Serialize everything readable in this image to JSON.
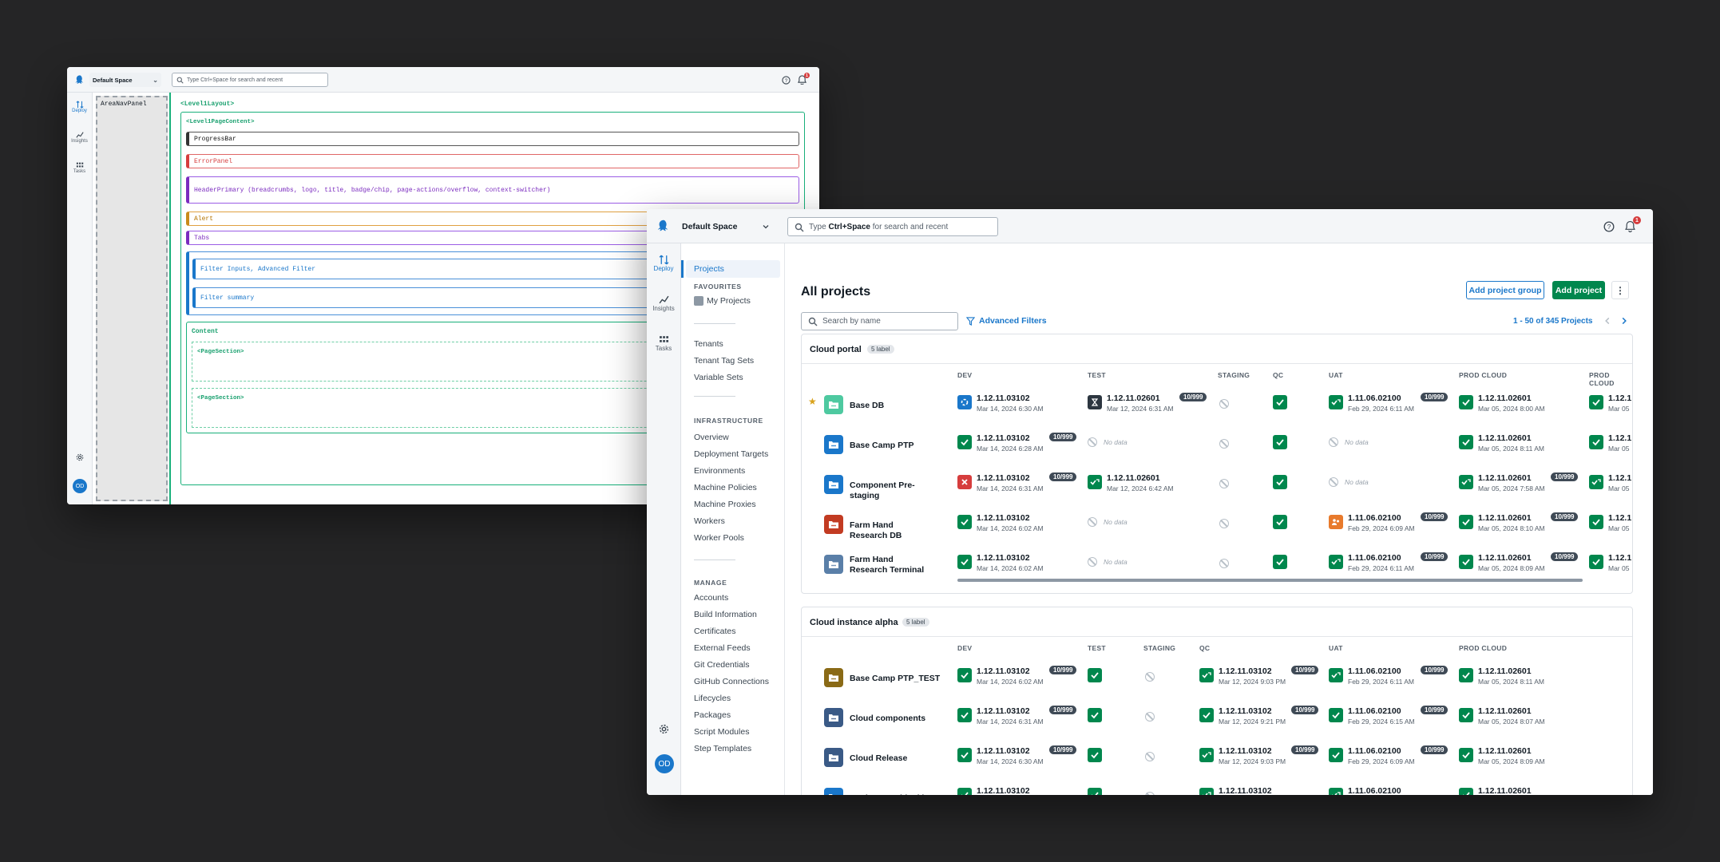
{
  "back_window": {
    "space_label": "Default Space",
    "search_placeholder": "Type Ctrl+Space for search and recent",
    "notif_count": "1",
    "rail": [
      {
        "label": "Deploy",
        "icon": "deploy-icon"
      },
      {
        "label": "Insights",
        "icon": "insights-icon"
      },
      {
        "label": "Tasks",
        "icon": "tasks-icon"
      }
    ],
    "avatar": "OD",
    "area_nav_panel": "AreaNavPanel",
    "level1_layout": "<Level1Layout>",
    "level1_page_content": "<Level1PageContent>",
    "progress_bar": "ProgressBar",
    "error_panel": "ErrorPanel",
    "header_primary": "HeaderPrimary (breadcrumbs, logo, title, badge/chip, page-actions/overflow, context-switcher)",
    "alert": "Alert",
    "tabs": "Tabs",
    "filter_inputs": "Filter Inputs, Advanced Filter",
    "filter_summary": "Filter summary",
    "content": "Content",
    "page_section_1": "<PageSection>",
    "page_section_2": "<PageSection>"
  },
  "front_window": {
    "space_label": "Default Space",
    "search_placeholder_pre": "Type ",
    "search_placeholder_key": "Ctrl+Space",
    "search_placeholder_post": " for search and recent",
    "notif_count": "1",
    "rail": [
      {
        "label": "Deploy",
        "icon": "deploy-icon"
      },
      {
        "label": "Insights",
        "icon": "insights-icon"
      },
      {
        "label": "Tasks",
        "icon": "tasks-icon"
      }
    ],
    "avatar": "OD",
    "sidebar": {
      "projects": "Projects",
      "favourites_heading": "FAVOURITES",
      "my_projects": "My Projects",
      "group1": [
        "Tenants",
        "Tenant Tag Sets",
        "Variable Sets"
      ],
      "infrastructure_heading": "INFRASTRUCTURE",
      "infrastructure": [
        "Overview",
        "Deployment Targets",
        "Environments",
        "Machine Policies",
        "Machine Proxies",
        "Workers",
        "Worker Pools"
      ],
      "manage_heading": "MANAGE",
      "manage": [
        "Accounts",
        "Build Information",
        "Certificates",
        "External Feeds",
        "Git Credentials",
        "GitHub Connections",
        "Lifecycles",
        "Packages",
        "Script Modules",
        "Step Templates"
      ]
    },
    "page_title": "All projects",
    "add_project_group": "Add project group",
    "add_project": "Add project",
    "search_by_name": "Search by name",
    "advanced_filters": "Advanced Filters",
    "pagination": "1 - 50 of 345 Projects",
    "groups": [
      {
        "name": "Cloud portal",
        "label": "5 label",
        "columns": [
          "DEV",
          "TEST",
          "STAGING",
          "QC",
          "UAT",
          "PROD CLOUD",
          "PROD CLOUD"
        ],
        "rows": [
          {
            "name": "Base DB",
            "favourite": true,
            "dev": {
              "status": "in-progress",
              "rel": "1.12.11.03102",
              "date": "Mar 14, 2024 6:30 AM"
            },
            "test": {
              "status": "queued",
              "rel": "1.12.11.02601",
              "date": "Mar 12, 2024 6:31 AM",
              "tag": "10/999"
            },
            "qc": {
              "status": "success"
            },
            "uat": {
              "status": "success-arrow",
              "rel": "1.11.06.02100",
              "date": "Feb 29, 2024 6:11 AM",
              "tag": "10/999"
            },
            "prod": {
              "status": "success",
              "rel": "1.12.11.02601",
              "date": "Mar 05, 2024 8:00 AM"
            },
            "prod2": {
              "status": "success",
              "rel": "1.12.1",
              "date": "Mar 05"
            }
          },
          {
            "name": "Base Camp PTP",
            "dev": {
              "status": "success",
              "rel": "1.12.11.03102",
              "date": "Mar 14, 2024 6:28 AM",
              "tag": "10/999"
            },
            "test": {
              "status": "nodata",
              "text": "No data"
            },
            "qc": {
              "status": "success"
            },
            "uat": {
              "status": "nodata",
              "text": "No data"
            },
            "prod": {
              "status": "success",
              "rel": "1.12.11.02601",
              "date": "Mar 05, 2024 8:11 AM"
            },
            "prod2": {
              "status": "success",
              "rel": "1.12.1",
              "date": "Mar 05"
            }
          },
          {
            "name": "Component Pre-staging",
            "dev": {
              "status": "failed",
              "rel": "1.12.11.03102",
              "date": "Mar 14, 2024 6:31 AM",
              "tag": "10/999"
            },
            "test": {
              "status": "success-arrow",
              "rel": "1.12.11.02601",
              "date": "Mar 12, 2024 6:42 AM"
            },
            "qc": {
              "status": "success"
            },
            "uat": {
              "status": "nodata",
              "text": "No data"
            },
            "prod": {
              "status": "success-arrow",
              "rel": "1.12.11.02601",
              "date": "Mar 05, 2024 7:58 AM",
              "tag": "10/999"
            },
            "prod2": {
              "status": "success-arrow",
              "rel": "1.12.1",
              "date": "Mar 05"
            }
          },
          {
            "name": "Farm Hand Research DB",
            "dev": {
              "status": "success",
              "rel": "1.12.11.03102",
              "date": "Mar 14, 2024 6:02 AM"
            },
            "test": {
              "status": "nodata",
              "text": "No data"
            },
            "qc": {
              "status": "success"
            },
            "uat": {
              "status": "manual",
              "rel": "1.11.06.02100",
              "date": "Feb 29, 2024 6:09 AM",
              "tag": "10/999"
            },
            "prod": {
              "status": "success",
              "rel": "1.12.11.02601",
              "date": "Mar 05, 2024 8:10 AM",
              "tag": "10/999"
            },
            "prod2": {
              "status": "success",
              "rel": "1.12.1",
              "date": "Mar 05"
            }
          },
          {
            "name": "Farm Hand Research Terminal",
            "dev": {
              "status": "success",
              "rel": "1.12.11.03102",
              "date": "Mar 14, 2024 6:02 AM"
            },
            "test": {
              "status": "nodata",
              "text": "No data"
            },
            "qc": {
              "status": "success"
            },
            "uat": {
              "status": "success-arrow",
              "rel": "1.11.06.02100",
              "date": "Feb 29, 2024 6:11 AM",
              "tag": "10/999"
            },
            "prod": {
              "status": "success",
              "rel": "1.12.11.02601",
              "date": "Mar 05, 2024 8:09 AM",
              "tag": "10/999"
            },
            "prod2": {
              "status": "success",
              "rel": "1.12.1",
              "date": "Mar 05"
            }
          }
        ]
      },
      {
        "name": "Cloud instance alpha",
        "label": "5 label",
        "columns": [
          "DEV",
          "TEST",
          "STAGING",
          "QC",
          "UAT",
          "PROD CLOUD"
        ],
        "rows": [
          {
            "name": "Base Camp PTP_TEST",
            "dev": {
              "status": "success",
              "rel": "1.12.11.03102",
              "date": "Mar 14, 2024 6:02 AM",
              "tag": "10/999"
            },
            "test": {
              "status": "success"
            },
            "qc": {
              "status": "success-arrow",
              "rel": "1.12.11.03102",
              "date": "Mar 12, 2024 9:03 PM",
              "tag": "10/999"
            },
            "uat": {
              "status": "success-arrow",
              "rel": "1.11.06.02100",
              "date": "Feb 29, 2024 6:11 AM",
              "tag": "10/999"
            },
            "prod": {
              "status": "success",
              "rel": "1.12.11.02601",
              "date": "Mar 05, 2024 8:11 AM"
            }
          },
          {
            "name": "Cloud components",
            "dev": {
              "status": "success",
              "rel": "1.12.11.03102",
              "date": "Mar 14, 2024 6:31 AM",
              "tag": "10/999"
            },
            "test": {
              "status": "success"
            },
            "qc": {
              "status": "success",
              "rel": "1.12.11.03102",
              "date": "Mar 12, 2024 9:21 PM",
              "tag": "10/999"
            },
            "uat": {
              "status": "success",
              "rel": "1.11.06.02100",
              "date": "Feb 29, 2024 6:15 AM",
              "tag": "10/999"
            },
            "prod": {
              "status": "success",
              "rel": "1.12.11.02601",
              "date": "Mar 05, 2024 8:07 AM"
            }
          },
          {
            "name": "Cloud Release",
            "dev": {
              "status": "success",
              "rel": "1.12.11.03102",
              "date": "Mar 14, 2024 6:30 AM",
              "tag": "10/999"
            },
            "test": {
              "status": "success"
            },
            "qc": {
              "status": "success-arrow",
              "rel": "1.12.11.03102",
              "date": "Mar 12, 2024 9:03 PM",
              "tag": "10/999"
            },
            "uat": {
              "status": "success",
              "rel": "1.11.06.02100",
              "date": "Feb 29, 2024 6:09 AM",
              "tag": "10/999"
            },
            "prod": {
              "status": "success",
              "rel": "1.12.11.02601",
              "date": "Mar 05, 2024 8:09 AM"
            }
          },
          {
            "name": "Deployment blocking start",
            "dev": {
              "status": "success",
              "rel": "1.12.11.03102",
              "date": ""
            },
            "test": {
              "status": "success"
            },
            "qc": {
              "status": "success-arrow",
              "rel": "1.12.11.03102",
              "date": ""
            },
            "uat": {
              "status": "success-arrow",
              "rel": "1.11.06.02100",
              "date": ""
            },
            "prod": {
              "status": "success",
              "rel": "1.12.11.02601",
              "date": ""
            }
          }
        ]
      }
    ]
  },
  "colors": {
    "green": "#00874d",
    "blue": "#1a77ca",
    "red": "#d63d3d",
    "orange": "#e87a2c",
    "purple": "#7b2cbf",
    "teal": "#18b07a"
  }
}
